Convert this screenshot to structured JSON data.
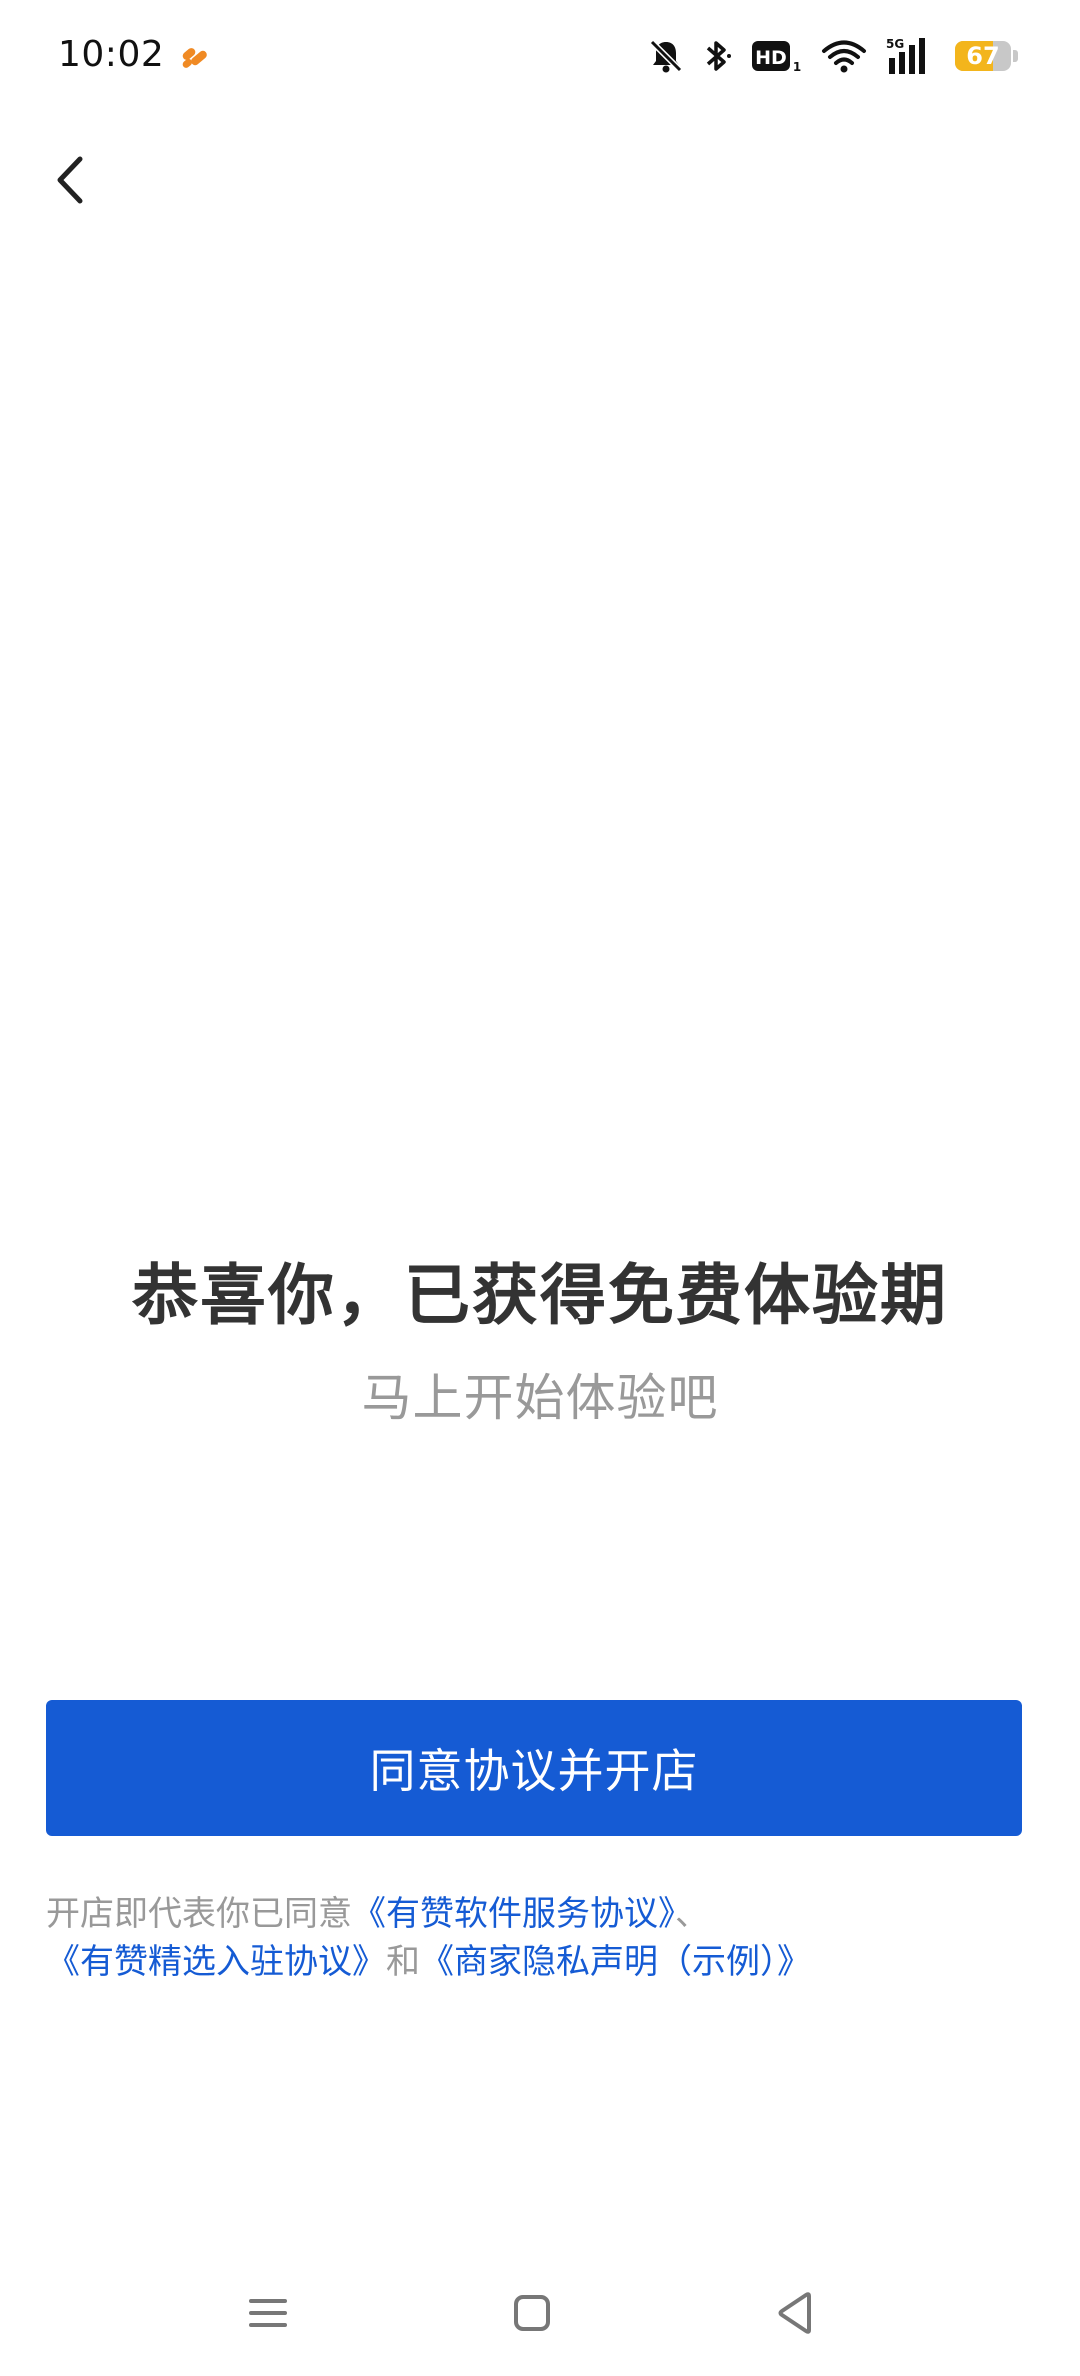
{
  "status_bar": {
    "time": "10:02",
    "network": "5G",
    "hd_label": "HD",
    "hd_sub": "1",
    "battery_level": 67,
    "battery_text": "67",
    "battery_color": "#f3b51c",
    "app_icon_color": "#f08a24",
    "icons": [
      "app-notification-icon",
      "mute-bell-icon",
      "bluetooth-icon",
      "hd-voice-icon",
      "wifi-icon",
      "cellular-signal-icon",
      "battery-icon"
    ]
  },
  "header": {
    "back_icon": "chevron-left-icon"
  },
  "main": {
    "title": "恭喜你，已获得免费体验期",
    "subtitle": "马上开始体验吧",
    "primary_button_label": "同意协议并开店",
    "primary_color": "#155bd4"
  },
  "agreement": {
    "prefix": "开店即代表你已同意",
    "link_1": "《有赞软件服务协议》",
    "separator": "、",
    "link_2": "《有赞精选入驻协议》",
    "conjunction": "和",
    "link_3": "《商家隐私声明（示例）》"
  },
  "nav_bar": {
    "icons": [
      "menu-icon",
      "home-icon",
      "back-triangle-icon"
    ]
  }
}
